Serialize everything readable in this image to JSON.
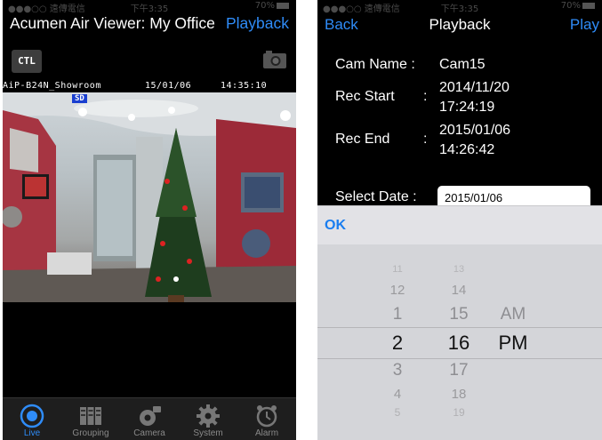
{
  "left": {
    "status": {
      "carrier": "●●●○○ 遠傳電信",
      "time": "下午3:35",
      "battery": "70%"
    },
    "title": "Acumen Air Viewer: My Office",
    "playback_label": "Playback",
    "ctl_label": "CTL",
    "osd": {
      "name": "AiP-B24N_Showroom",
      "date": "15/01/06",
      "time": "14:35:10",
      "badge": "SD"
    },
    "tabs": [
      {
        "label": "Live",
        "icon": "live-icon",
        "active": true
      },
      {
        "label": "Grouping",
        "icon": "grouping-icon"
      },
      {
        "label": "Camera",
        "icon": "camera-gear-icon"
      },
      {
        "label": "System",
        "icon": "gear-icon"
      },
      {
        "label": "Alarm",
        "icon": "alarm-clock-icon"
      }
    ]
  },
  "right": {
    "status": {
      "carrier": "●●●○○ 遠傳電信",
      "time": "下午3:35",
      "battery": "70%"
    },
    "back_label": "Back",
    "title": "Playback",
    "play_label": "Play",
    "cam_name": {
      "label": "Cam Name :",
      "value": "Cam15"
    },
    "rec_start": {
      "label": "Rec Start",
      "colon": ":",
      "date": "2014/11/20",
      "time": "17:24:19"
    },
    "rec_end": {
      "label": "Rec End",
      "colon": ":",
      "date": "2015/01/06",
      "time": "14:26:42"
    },
    "select_date": {
      "label": "Select Date :",
      "value": "2015/01/06"
    },
    "ok_label": "OK",
    "picker": {
      "hours": [
        "11",
        "12",
        "1",
        "2",
        "3",
        "4",
        "5"
      ],
      "minutes": [
        "13",
        "14",
        "15",
        "16",
        "17",
        "18",
        "19"
      ],
      "ampm": [
        "AM",
        "PM"
      ]
    }
  },
  "colors": {
    "accent": "#2f8cf8",
    "tab_bg": "#1e1e1e",
    "picker_bg": "#d4d5d9"
  }
}
